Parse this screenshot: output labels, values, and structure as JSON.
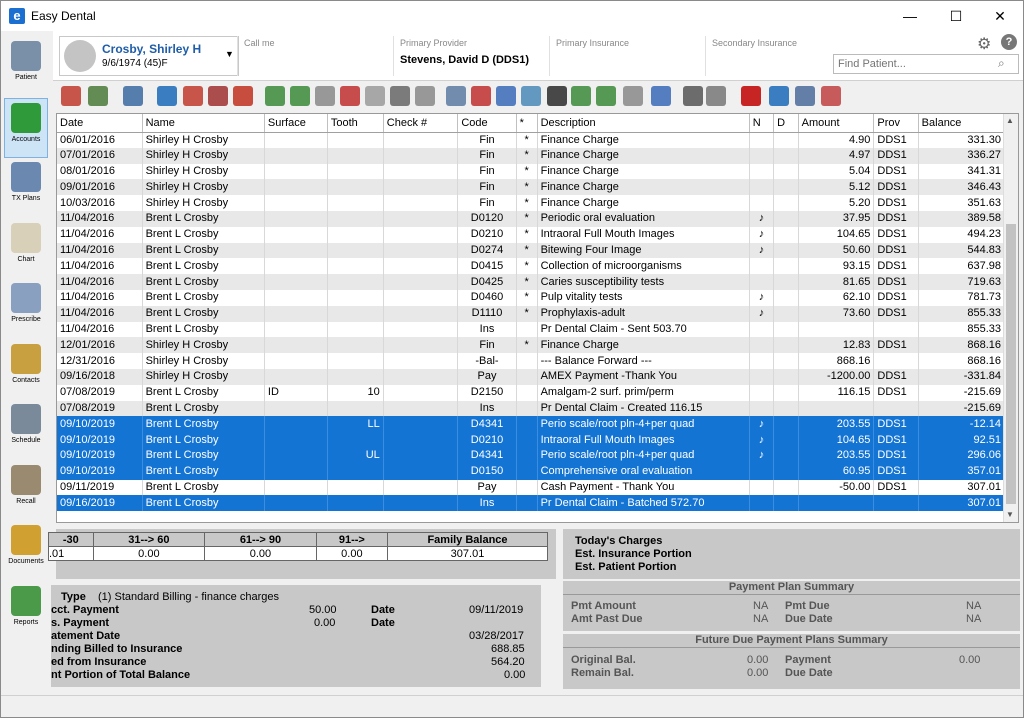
{
  "window": {
    "title": "Easy Dental",
    "app_icon": "e",
    "minimize": "—",
    "maximize": "☐",
    "close": "✕"
  },
  "nav": [
    {
      "label": "Patient",
      "icon": "patient-icon",
      "color": "#7a8fa8"
    },
    {
      "label": "Accounts",
      "icon": "accounts-icon",
      "color": "#2e9a3a"
    },
    {
      "label": "TX Plans",
      "icon": "tx-plans-icon",
      "color": "#6a88b0"
    },
    {
      "label": "Chart",
      "icon": "tooth-icon",
      "color": "#d8d0b8"
    },
    {
      "label": "Prescribe",
      "icon": "prescribe-icon",
      "color": "#8aa0c0"
    },
    {
      "label": "Contacts",
      "icon": "contacts-icon",
      "color": "#c8a040"
    },
    {
      "label": "Schedule",
      "icon": "schedule-icon",
      "color": "#7a8a9a"
    },
    {
      "label": "Recall",
      "icon": "recall-icon",
      "color": "#9a8a70"
    },
    {
      "label": "Documents",
      "icon": "documents-icon",
      "color": "#d0a030"
    },
    {
      "label": "Reports",
      "icon": "reports-icon",
      "color": "#4a9a4a"
    }
  ],
  "header": {
    "patient_name": "Crosby, Shirley H",
    "patient_dob": "9/6/1974 (45)F",
    "call_me_label": "Call me",
    "call_me_value": "",
    "primary_provider_label": "Primary Provider",
    "primary_provider_value": "Stevens, David D  (DDS1)",
    "primary_insurance_label": "Primary Insurance",
    "secondary_insurance_label": "Secondary Insurance",
    "find_patient_placeholder": "Find Patient...",
    "help": "?"
  },
  "toolbar": {
    "colors": [
      "#c0392b",
      "#4a7a3a",
      "#3a6aa0",
      "#1a6ab8",
      "#c0392b",
      "#a03030",
      "#c03020",
      "#3a8a3a",
      "#3a8a3a",
      "#888888",
      "#c03030",
      "#9a9a9a",
      "#666666",
      "#888888",
      "#5a7aa0",
      "#c03030",
      "#3a6ab8",
      "#4a8ab8",
      "#2a2a2a",
      "#3a8a3a",
      "#3a8a3a",
      "#888888",
      "#3a6ab8",
      "#555555",
      "#777777",
      "#c00000",
      "#1a6ab8",
      "#4a6a9a",
      "#c04040"
    ]
  },
  "ledger": {
    "columns": [
      "Date",
      "Name",
      "Surface",
      "Tooth",
      "Check #",
      "Code",
      "*",
      "Description",
      "N",
      "D",
      "Amount",
      "Prov",
      "Balance"
    ],
    "rows": [
      {
        "date": "06/01/2016",
        "name": "Shirley H Crosby",
        "surface": "",
        "tooth": "",
        "check": "",
        "code": "Fin",
        "star": "*",
        "desc": "Finance Charge",
        "n": "",
        "d": "",
        "amount": "4.90",
        "prov": "DDS1",
        "balance": "331.30",
        "selected": false
      },
      {
        "date": "07/01/2016",
        "name": "Shirley H Crosby",
        "surface": "",
        "tooth": "",
        "check": "",
        "code": "Fin",
        "star": "*",
        "desc": "Finance Charge",
        "n": "",
        "d": "",
        "amount": "4.97",
        "prov": "DDS1",
        "balance": "336.27",
        "selected": false
      },
      {
        "date": "08/01/2016",
        "name": "Shirley H Crosby",
        "surface": "",
        "tooth": "",
        "check": "",
        "code": "Fin",
        "star": "*",
        "desc": "Finance Charge",
        "n": "",
        "d": "",
        "amount": "5.04",
        "prov": "DDS1",
        "balance": "341.31",
        "selected": false
      },
      {
        "date": "09/01/2016",
        "name": "Shirley H Crosby",
        "surface": "",
        "tooth": "",
        "check": "",
        "code": "Fin",
        "star": "*",
        "desc": "Finance Charge",
        "n": "",
        "d": "",
        "amount": "5.12",
        "prov": "DDS1",
        "balance": "346.43",
        "selected": false
      },
      {
        "date": "10/03/2016",
        "name": "Shirley H Crosby",
        "surface": "",
        "tooth": "",
        "check": "",
        "code": "Fin",
        "star": "*",
        "desc": "Finance Charge",
        "n": "",
        "d": "",
        "amount": "5.20",
        "prov": "DDS1",
        "balance": "351.63",
        "selected": false
      },
      {
        "date": "11/04/2016",
        "name": "Brent L Crosby",
        "surface": "",
        "tooth": "",
        "check": "",
        "code": "D0120",
        "star": "*",
        "desc": "Periodic oral evaluation",
        "n": "♪",
        "d": "",
        "amount": "37.95",
        "prov": "DDS1",
        "balance": "389.58",
        "selected": false
      },
      {
        "date": "11/04/2016",
        "name": "Brent L Crosby",
        "surface": "",
        "tooth": "",
        "check": "",
        "code": "D0210",
        "star": "*",
        "desc": "Intraoral Full Mouth Images",
        "n": "♪",
        "d": "",
        "amount": "104.65",
        "prov": "DDS1",
        "balance": "494.23",
        "selected": false
      },
      {
        "date": "11/04/2016",
        "name": "Brent L Crosby",
        "surface": "",
        "tooth": "",
        "check": "",
        "code": "D0274",
        "star": "*",
        "desc": "Bitewing Four Image",
        "n": "♪",
        "d": "",
        "amount": "50.60",
        "prov": "DDS1",
        "balance": "544.83",
        "selected": false
      },
      {
        "date": "11/04/2016",
        "name": "Brent L Crosby",
        "surface": "",
        "tooth": "",
        "check": "",
        "code": "D0415",
        "star": "*",
        "desc": "Collection of microorganisms",
        "n": "",
        "d": "",
        "amount": "93.15",
        "prov": "DDS1",
        "balance": "637.98",
        "selected": false
      },
      {
        "date": "11/04/2016",
        "name": "Brent L Crosby",
        "surface": "",
        "tooth": "",
        "check": "",
        "code": "D0425",
        "star": "*",
        "desc": "Caries susceptibility tests",
        "n": "",
        "d": "",
        "amount": "81.65",
        "prov": "DDS1",
        "balance": "719.63",
        "selected": false
      },
      {
        "date": "11/04/2016",
        "name": "Brent L Crosby",
        "surface": "",
        "tooth": "",
        "check": "",
        "code": "D0460",
        "star": "*",
        "desc": "Pulp vitality tests",
        "n": "♪",
        "d": "",
        "amount": "62.10",
        "prov": "DDS1",
        "balance": "781.73",
        "selected": false
      },
      {
        "date": "11/04/2016",
        "name": "Brent L Crosby",
        "surface": "",
        "tooth": "",
        "check": "",
        "code": "D1110",
        "star": "*",
        "desc": "Prophylaxis-adult",
        "n": "♪",
        "d": "",
        "amount": "73.60",
        "prov": "DDS1",
        "balance": "855.33",
        "selected": false
      },
      {
        "date": "11/04/2016",
        "name": "Brent L Crosby",
        "surface": "",
        "tooth": "",
        "check": "",
        "code": "Ins",
        "star": "",
        "desc": "Pr Dental Claim - Sent 503.70",
        "n": "",
        "d": "",
        "amount": "",
        "prov": "",
        "balance": "855.33",
        "selected": false
      },
      {
        "date": "12/01/2016",
        "name": "Shirley H Crosby",
        "surface": "",
        "tooth": "",
        "check": "",
        "code": "Fin",
        "star": "*",
        "desc": "Finance Charge",
        "n": "",
        "d": "",
        "amount": "12.83",
        "prov": "DDS1",
        "balance": "868.16",
        "selected": false
      },
      {
        "date": "12/31/2016",
        "name": "Shirley H Crosby",
        "surface": "",
        "tooth": "",
        "check": "",
        "code": "-Bal-",
        "star": "",
        "desc": "--- Balance Forward ---",
        "n": "",
        "d": "",
        "amount": "868.16",
        "prov": "",
        "balance": "868.16",
        "selected": false
      },
      {
        "date": "09/16/2018",
        "name": "Shirley H Crosby",
        "surface": "",
        "tooth": "",
        "check": "",
        "code": "Pay",
        "star": "",
        "desc": "AMEX Payment -Thank You",
        "n": "",
        "d": "",
        "amount": "-1200.00",
        "prov": "DDS1",
        "balance": "-331.84",
        "selected": false
      },
      {
        "date": "07/08/2019",
        "name": "Brent L Crosby",
        "surface": "ID",
        "tooth": "10",
        "check": "",
        "code": "D2150",
        "star": "",
        "desc": "Amalgam-2 surf. prim/perm",
        "n": "",
        "d": "",
        "amount": "116.15",
        "prov": "DDS1",
        "balance": "-215.69",
        "selected": false
      },
      {
        "date": "07/08/2019",
        "name": "Brent L Crosby",
        "surface": "",
        "tooth": "",
        "check": "",
        "code": "Ins",
        "star": "",
        "desc": "Pr Dental Claim - Created 116.15",
        "n": "",
        "d": "",
        "amount": "",
        "prov": "",
        "balance": "-215.69",
        "selected": false
      },
      {
        "date": "09/10/2019",
        "name": "Brent L Crosby",
        "surface": "",
        "tooth": "LL",
        "check": "",
        "code": "D4341",
        "star": "",
        "desc": "Perio scale/root pln-4+per quad",
        "n": "♪",
        "d": "",
        "amount": "203.55",
        "prov": "DDS1",
        "balance": "-12.14",
        "selected": true
      },
      {
        "date": "09/10/2019",
        "name": "Brent L Crosby",
        "surface": "",
        "tooth": "",
        "check": "",
        "code": "D0210",
        "star": "",
        "desc": "Intraoral Full Mouth Images",
        "n": "♪",
        "d": "",
        "amount": "104.65",
        "prov": "DDS1",
        "balance": "92.51",
        "selected": true
      },
      {
        "date": "09/10/2019",
        "name": "Brent L Crosby",
        "surface": "",
        "tooth": "UL",
        "check": "",
        "code": "D4341",
        "star": "",
        "desc": "Perio scale/root pln-4+per quad",
        "n": "♪",
        "d": "",
        "amount": "203.55",
        "prov": "DDS1",
        "balance": "296.06",
        "selected": true
      },
      {
        "date": "09/10/2019",
        "name": "Brent L Crosby",
        "surface": "",
        "tooth": "",
        "check": "",
        "code": "D0150",
        "star": "",
        "desc": "Comprehensive oral evaluation",
        "n": "",
        "d": "",
        "amount": "60.95",
        "prov": "DDS1",
        "balance": "357.01",
        "selected": true
      },
      {
        "date": "09/11/2019",
        "name": "Brent L Crosby",
        "surface": "",
        "tooth": "",
        "check": "",
        "code": "Pay",
        "star": "",
        "desc": "Cash Payment - Thank You",
        "n": "",
        "d": "",
        "amount": "-50.00",
        "prov": "DDS1",
        "balance": "307.01",
        "selected": false
      },
      {
        "date": "09/16/2019",
        "name": "Brent L Crosby",
        "surface": "",
        "tooth": "",
        "check": "",
        "code": "Ins",
        "star": "",
        "desc": "Pr Dental Claim - Batched 572.70",
        "n": "",
        "d": "",
        "amount": "",
        "prov": "",
        "balance": "307.01",
        "selected": true
      }
    ]
  },
  "aging": {
    "headers": [
      "-30",
      "31--> 60",
      "61--> 90",
      "91-->",
      "Family Balance"
    ],
    "values": [
      ".01",
      "0.00",
      "0.00",
      "0.00",
      "307.01"
    ]
  },
  "charges": {
    "todays": "Today's Charges",
    "est_ins": "Est. Insurance Portion",
    "est_pat": "Est. Patient Portion"
  },
  "billing": {
    "type_label": "Type",
    "type_value": "(1) Standard Billing - finance charges",
    "last_payment_label": "cct. Payment",
    "last_payment_value": "50.00",
    "last_payment_date_label": "Date",
    "last_payment_date": "09/11/2019",
    "ins_payment_label": "s. Payment",
    "ins_payment_value": "0.00",
    "ins_payment_date_label": "Date",
    "statement_date_label": "atement Date",
    "statement_date": "03/28/2017",
    "pending_label": "nding Billed to Insurance",
    "pending_value": "688.85",
    "expected_label": "ed from Insurance",
    "expected_value": "564.20",
    "patient_portion_label": "nt Portion of Total Balance",
    "patient_portion_value": "0.00"
  },
  "payment_plan": {
    "title": "Payment Plan Summary",
    "pmt_amount_label": "Pmt Amount",
    "pmt_amount": "NA",
    "pmt_due_label": "Pmt Due",
    "pmt_due": "NA",
    "amt_past_due_label": "Amt Past Due",
    "amt_past_due": "NA",
    "due_date_label": "Due Date",
    "due_date": "NA"
  },
  "future_plan": {
    "title": "Future Due Payment Plans Summary",
    "original_bal_label": "Original Bal.",
    "original_bal": "0.00",
    "payment_label": "Payment",
    "payment": "0.00",
    "remain_bal_label": "Remain Bal.",
    "remain_bal": "0.00",
    "due_date_label": "Due Date"
  }
}
